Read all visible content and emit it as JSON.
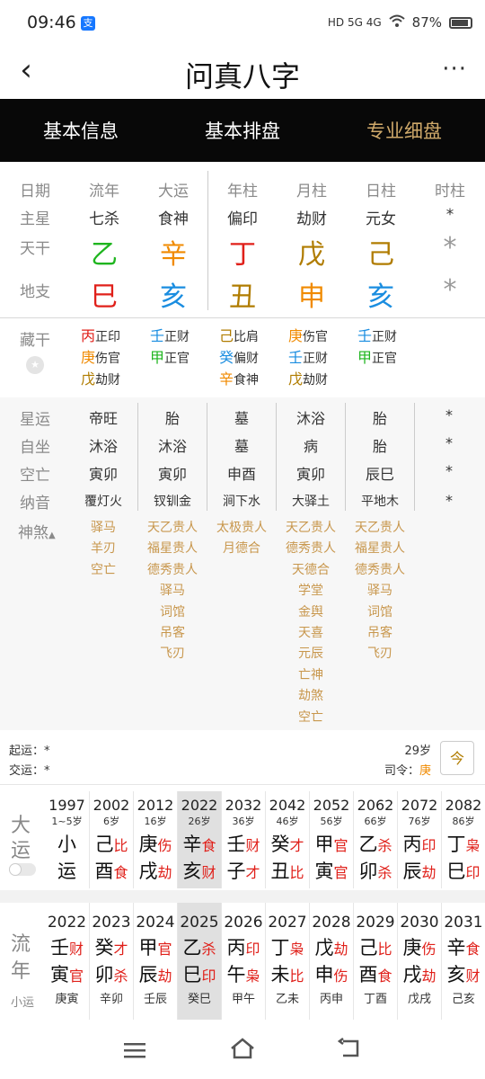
{
  "status": {
    "time": "09:46",
    "app_badge": "支",
    "signal": "HD 5G 4G",
    "battery": "87%"
  },
  "header": {
    "title": "问真八字",
    "back": "‹",
    "more": "···"
  },
  "tabs": [
    "基本信息",
    "基本排盘",
    "专业细盘"
  ],
  "chart": {
    "col_headers": [
      "流年",
      "大运",
      "年柱",
      "月柱",
      "日柱",
      "时柱"
    ],
    "row_labels": {
      "date": "日期",
      "zhuxing": "主星",
      "tiangan": "天干",
      "dizhi": "地支"
    },
    "zhuxing": [
      "七杀",
      "食神",
      "偏印",
      "劫财",
      "元女",
      "*"
    ],
    "tiangan": [
      {
        "c": "乙",
        "color": "#1fb51f"
      },
      {
        "c": "辛",
        "color": "#f08a00"
      },
      {
        "c": "丁",
        "color": "#e0201a"
      },
      {
        "c": "戊",
        "color": "#b07c00"
      },
      {
        "c": "己",
        "color": "#b07c00"
      },
      {
        "c": "*",
        "color": "#999999"
      }
    ],
    "dizhi": [
      {
        "c": "巳",
        "color": "#e0201a"
      },
      {
        "c": "亥",
        "color": "#1a8de0"
      },
      {
        "c": "丑",
        "color": "#b07c00"
      },
      {
        "c": "申",
        "color": "#f08a00"
      },
      {
        "c": "亥",
        "color": "#1a8de0"
      },
      {
        "c": "*",
        "color": "#999999"
      }
    ]
  },
  "canggan": {
    "label": "藏干",
    "cols": [
      [
        {
          "g": "丙",
          "color": "#e0201a",
          "t": "正印"
        },
        {
          "g": "庚",
          "color": "#f08a00",
          "t": "伤官"
        },
        {
          "g": "戊",
          "color": "#b07c00",
          "t": "劫财"
        }
      ],
      [
        {
          "g": "壬",
          "color": "#1a8de0",
          "t": "正财"
        },
        {
          "g": "甲",
          "color": "#1fb51f",
          "t": "正官"
        }
      ],
      [
        {
          "g": "己",
          "color": "#b07c00",
          "t": "比肩"
        },
        {
          "g": "癸",
          "color": "#1a8de0",
          "t": "偏财"
        },
        {
          "g": "辛",
          "color": "#f08a00",
          "t": "食神"
        }
      ],
      [
        {
          "g": "庚",
          "color": "#f08a00",
          "t": "伤官"
        },
        {
          "g": "壬",
          "color": "#1a8de0",
          "t": "正财"
        },
        {
          "g": "戊",
          "color": "#b07c00",
          "t": "劫财"
        }
      ],
      [
        {
          "g": "壬",
          "color": "#1a8de0",
          "t": "正财"
        },
        {
          "g": "甲",
          "color": "#1fb51f",
          "t": "正官"
        }
      ]
    ]
  },
  "xingyun": {
    "labels": [
      "星运",
      "自坐",
      "空亡",
      "纳音"
    ],
    "rows": [
      [
        "帝旺",
        "胎",
        "墓",
        "沐浴",
        "胎",
        "*"
      ],
      [
        "沐浴",
        "沐浴",
        "墓",
        "病",
        "胎",
        "*"
      ],
      [
        "寅卯",
        "寅卯",
        "申酉",
        "寅卯",
        "辰巳",
        "*"
      ],
      [
        "覆灯火",
        "钗钏金",
        "涧下水",
        "大驿土",
        "平地木",
        "*"
      ]
    ]
  },
  "shensha": {
    "label": "神煞",
    "cols": [
      [
        "驿马",
        "羊刃",
        "空亡"
      ],
      [
        "天乙贵人",
        "福星贵人",
        "德秀贵人",
        "驿马",
        "词馆",
        "吊客",
        "飞刃"
      ],
      [
        "太极贵人",
        "月德合"
      ],
      [
        "天乙贵人",
        "德秀贵人",
        "天德合",
        "学堂",
        "金舆",
        "天喜",
        "元辰",
        "亡神",
        "劫煞",
        "空亡"
      ],
      [
        "天乙贵人",
        "福星贵人",
        "德秀贵人",
        "驿马",
        "词馆",
        "吊客",
        "飞刃"
      ]
    ]
  },
  "qiyun": {
    "start_label": "起运：",
    "start_val": "*",
    "jiao_label": "交运：",
    "jiao_val": "*",
    "age": "29岁",
    "siling_label": "司令：",
    "siling_val": "庚",
    "icon_label": "今"
  },
  "dayun": {
    "label1": "大",
    "label2": "运",
    "cols": [
      {
        "year": "1997",
        "age": "1~5岁",
        "g": "小",
        "gt": "",
        "z": "运",
        "zt": ""
      },
      {
        "year": "2002",
        "age": "6岁",
        "g": "己",
        "gt": "比",
        "z": "酉",
        "zt": "食"
      },
      {
        "year": "2012",
        "age": "16岁",
        "g": "庚",
        "gt": "伤",
        "z": "戌",
        "zt": "劫"
      },
      {
        "year": "2022",
        "age": "26岁",
        "g": "辛",
        "gt": "食",
        "z": "亥",
        "zt": "财"
      },
      {
        "year": "2032",
        "age": "36岁",
        "g": "壬",
        "gt": "财",
        "z": "子",
        "zt": "才"
      },
      {
        "year": "2042",
        "age": "46岁",
        "g": "癸",
        "gt": "才",
        "z": "丑",
        "zt": "比"
      },
      {
        "year": "2052",
        "age": "56岁",
        "g": "甲",
        "gt": "官",
        "z": "寅",
        "zt": "官"
      },
      {
        "year": "2062",
        "age": "66岁",
        "g": "乙",
        "gt": "杀",
        "z": "卯",
        "zt": "杀"
      },
      {
        "year": "2072",
        "age": "76岁",
        "g": "丙",
        "gt": "印",
        "z": "辰",
        "zt": "劫"
      },
      {
        "year": "2082",
        "age": "86岁",
        "g": "丁",
        "gt": "枭",
        "z": "巳",
        "zt": "印"
      }
    ]
  },
  "liunian": {
    "label1": "流",
    "label2": "年",
    "label3": "小运",
    "cols": [
      {
        "year": "2022",
        "g": "壬",
        "gt": "财",
        "z": "寅",
        "zt": "官",
        "xy": "庚寅"
      },
      {
        "year": "2023",
        "g": "癸",
        "gt": "才",
        "z": "卯",
        "zt": "杀",
        "xy": "辛卯"
      },
      {
        "year": "2024",
        "g": "甲",
        "gt": "官",
        "z": "辰",
        "zt": "劫",
        "xy": "壬辰"
      },
      {
        "year": "2025",
        "g": "乙",
        "gt": "杀",
        "z": "巳",
        "zt": "印",
        "xy": "癸巳"
      },
      {
        "year": "2026",
        "g": "丙",
        "gt": "印",
        "z": "午",
        "zt": "枭",
        "xy": "甲午"
      },
      {
        "year": "2027",
        "g": "丁",
        "gt": "枭",
        "z": "未",
        "zt": "比",
        "xy": "乙未"
      },
      {
        "year": "2028",
        "g": "戊",
        "gt": "劫",
        "z": "申",
        "zt": "伤",
        "xy": "丙申"
      },
      {
        "year": "2029",
        "g": "己",
        "gt": "比",
        "z": "酉",
        "zt": "食",
        "xy": "丁酉"
      },
      {
        "year": "2030",
        "g": "庚",
        "gt": "伤",
        "z": "戌",
        "zt": "劫",
        "xy": "戊戌"
      },
      {
        "year": "2031",
        "g": "辛",
        "gt": "食",
        "z": "亥",
        "zt": "财",
        "xy": "己亥"
      }
    ]
  },
  "nav": {
    "menu": "menu-icon",
    "home": "home-icon",
    "back": "back-icon"
  }
}
